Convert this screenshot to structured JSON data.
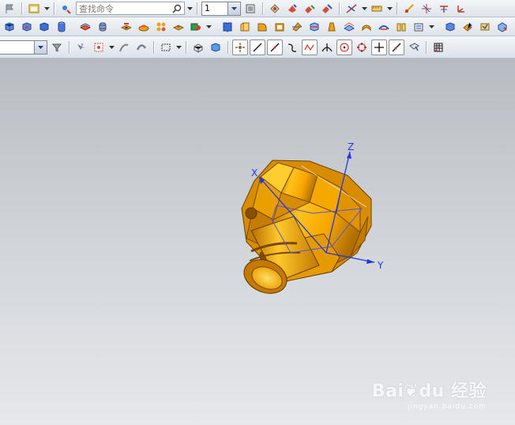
{
  "toolbar1": {
    "search_placeholder": "查找命令",
    "combo_value": "1"
  },
  "toolbar3": {
    "selection_filter_value": ""
  },
  "viewport": {
    "axes": {
      "x": "X",
      "y": "Y",
      "z": "Z"
    },
    "colors": {
      "part": "#f2a800",
      "axis": "#1e37e6",
      "background_top": "#b7bcc2",
      "background_bottom": "#e6e8eb"
    }
  },
  "watermark": {
    "brand_a": "Bai",
    "brand_b": "du",
    "brand_c": "经验",
    "url": "jingyan.baidu.com"
  }
}
